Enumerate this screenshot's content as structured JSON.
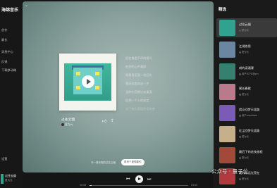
{
  "app": {
    "name": "海绵音乐"
  },
  "sidebar": {
    "items": [
      {
        "label": "创作"
      },
      {
        "label": "最长"
      },
      {
        "label": "消息中心"
      },
      {
        "label": "反馈"
      },
      {
        "label": "下载移动端"
      }
    ],
    "settings_label": "设置"
  },
  "mini_player": {
    "title": "过往云烟",
    "artist": "夏为元"
  },
  "now_playing": {
    "title": "过往云烟",
    "artist": "夏为元",
    "lyrics": [
      "回忆像是不停的雾光",
      "在你的心中凝固",
      "如果再见面一次回头",
      "我无法舍弃这一步",
      "当你在回想过去重温",
      "回到一个人的安定",
      "说了快乐是因为爱结束"
    ],
    "hint_text": "写一首你想的过往云烟",
    "hint_button": "再来个更想要的"
  },
  "playbar": {
    "current_time": "00:00",
    "total_time": "03:02",
    "progress": 0.02
  },
  "picks": {
    "title": "精选",
    "items": [
      {
        "title": "过往云烟",
        "artist": "夏为元",
        "color": "#2fa38f",
        "active": true
      },
      {
        "title": "江湖浪思",
        "artist": "夏为元",
        "color": "#6a86a3"
      },
      {
        "title": "胡的读通课",
        "artist": "用户8770@gm",
        "color": "#35806e"
      },
      {
        "title": "粥长春歌",
        "artist": "夏为元",
        "color": "#b97a8c"
      },
      {
        "title": "就让回梦天涯路",
        "artist": "用户hnsdmzb",
        "color": "#7a5bb5"
      },
      {
        "title": "红尘回梦天涯路",
        "artist": "夏为元",
        "color": "#c5b08a"
      },
      {
        "title": "最后下的花枝旅程",
        "artist": "夏为元",
        "color": "#a14a3a"
      },
      {
        "title": "我的永远光亮在",
        "artist": "夏为元",
        "color": "#b03a40"
      }
    ]
  },
  "watermark": "公众号 · 量子位"
}
